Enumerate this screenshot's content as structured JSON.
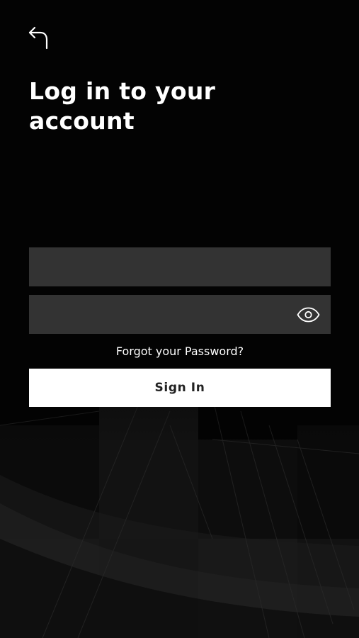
{
  "header": {
    "back_icon": "back-arrow-icon",
    "title": "Log in to your account"
  },
  "form": {
    "email": {
      "value": "",
      "placeholder": ""
    },
    "password": {
      "value": "",
      "placeholder": "",
      "visibility_icon": "eye-icon"
    },
    "forgot_label": "Forgot your Password?",
    "signin_label": "Sign In"
  },
  "theme": {
    "background": "#030303",
    "field_fill": "#333333",
    "button_fill": "#ffffff",
    "button_text": "#222222",
    "text": "#ffffff"
  }
}
